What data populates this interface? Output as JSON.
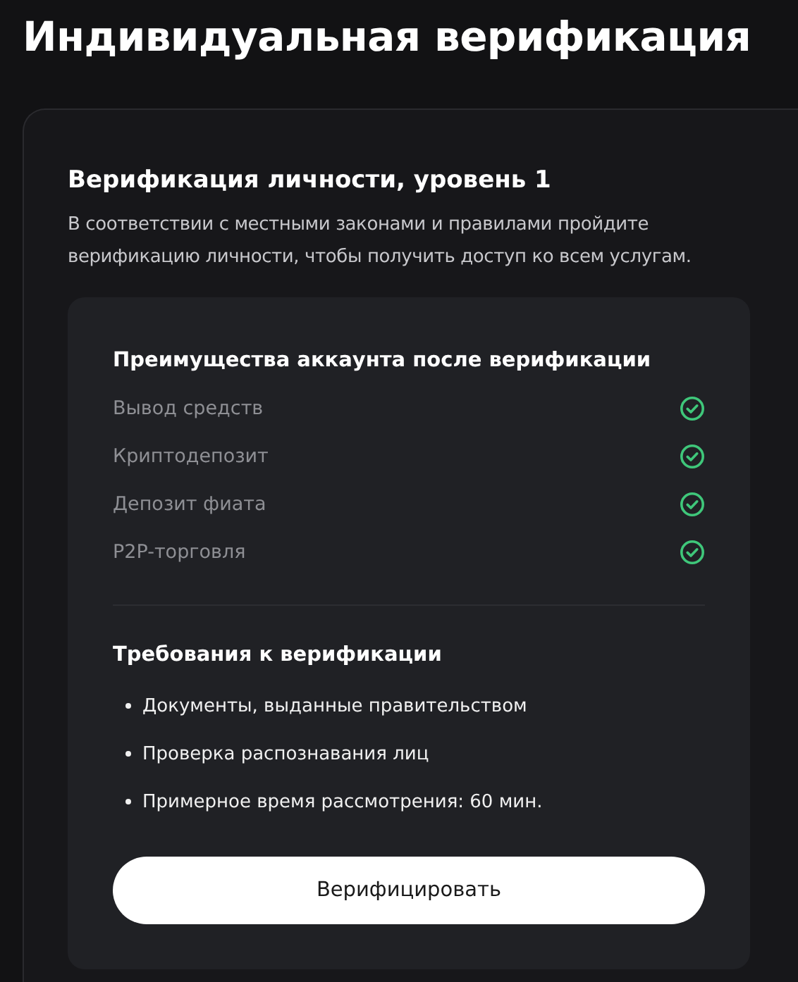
{
  "page_title": "Индивидуальная верификация",
  "card": {
    "title": "Верификация личности, уровень 1",
    "description": "В соответствии с местными законами и правилами пройдите верификацию личности, чтобы получить доступ ко всем услугам.",
    "benefits": {
      "title": "Преимущества аккаунта после верификации",
      "items": [
        {
          "label": "Вывод средств",
          "included": true
        },
        {
          "label": "Криптодепозит",
          "included": true
        },
        {
          "label": "Депозит фиата",
          "included": true
        },
        {
          "label": "P2P-торговля",
          "included": true
        }
      ]
    },
    "requirements": {
      "title": "Требования к верификации",
      "items": [
        "Документы, выданные правительством",
        "Проверка распознавания лиц",
        "Примерное время рассмотрения: 60 мин."
      ]
    },
    "button": "Верифицировать"
  }
}
